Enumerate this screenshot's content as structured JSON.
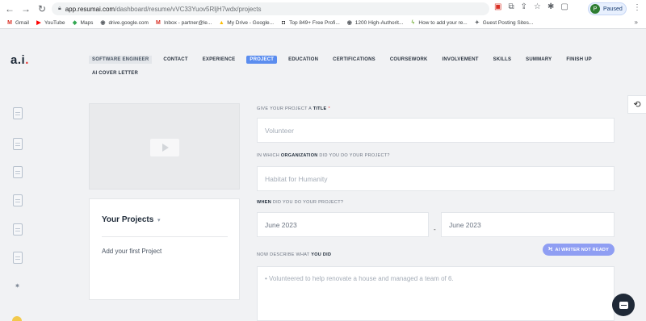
{
  "browser": {
    "url_host": "app.resumai.com",
    "url_path": "/dashboard/resume/vVC33Yuov5RljH7wdx/projects",
    "profile_label": "Paused",
    "profile_initial": "P"
  },
  "bookmarks": [
    {
      "label": "Gmail",
      "icon": "gmail-icon",
      "color": "#d93025",
      "glyph": "M"
    },
    {
      "label": "YouTube",
      "icon": "youtube-icon",
      "color": "#ff0000",
      "glyph": "▶"
    },
    {
      "label": "Maps",
      "icon": "maps-icon",
      "color": "#34a853",
      "glyph": "◆"
    },
    {
      "label": "drive.google.com",
      "icon": "globe-icon",
      "color": "#5f6368",
      "glyph": "◉"
    },
    {
      "label": "Inbox - partner@le...",
      "icon": "gmail-icon",
      "color": "#d93025",
      "glyph": "M"
    },
    {
      "label": "My Drive - Google...",
      "icon": "drive-icon",
      "color": "#fbbc04",
      "glyph": "▲"
    },
    {
      "label": "Top 849+ Free Profi...",
      "icon": "site-icon",
      "color": "#202124",
      "glyph": "◘"
    },
    {
      "label": "1200 High-Authorit...",
      "icon": "globe-icon",
      "color": "#5f6368",
      "glyph": "◉"
    },
    {
      "label": "How to add your re...",
      "icon": "bolt-icon",
      "color": "#7cb342",
      "glyph": "ϟ"
    },
    {
      "label": "Guest Posting Sites...",
      "icon": "star-icon",
      "color": "#5f6368",
      "glyph": "✦"
    }
  ],
  "app": {
    "logo_text": "a.i",
    "logo_dot": "."
  },
  "tabs": [
    {
      "label": "Software Engineer",
      "state": "soft"
    },
    {
      "label": "Contact",
      "state": "normal"
    },
    {
      "label": "Experience",
      "state": "normal"
    },
    {
      "label": "Project",
      "state": "active"
    },
    {
      "label": "Education",
      "state": "normal"
    },
    {
      "label": "Certifications",
      "state": "normal"
    },
    {
      "label": "Coursework",
      "state": "normal"
    },
    {
      "label": "Involvement",
      "state": "normal"
    },
    {
      "label": "Skills",
      "state": "normal"
    },
    {
      "label": "Summary",
      "state": "normal"
    },
    {
      "label": "Finish Up",
      "state": "normal"
    }
  ],
  "tabs_row2": [
    {
      "label": "AI Cover Letter",
      "state": "normal"
    }
  ],
  "projects_panel": {
    "title": "Your Projects",
    "add_text": "Add your first Project"
  },
  "form": {
    "title_label_pre": "Give your project a",
    "title_label_bold": "title",
    "title_label_star": "*",
    "title_placeholder": "Volunteer",
    "org_label_pre": "In which",
    "org_label_bold": "organization",
    "org_label_post": "did you do your project?",
    "org_placeholder": "Habitat for Humanity",
    "when_label_bold": "When",
    "when_label_post": "did you do your project?",
    "start_value": "June 2023",
    "dash": "-",
    "end_value": "June 2023",
    "describe_label_pre": "Now describe what",
    "describe_label_bold": "you did",
    "ai_button": "AI Writer Not Ready",
    "describe_placeholder": "• Volunteered to help renovate a house and managed a team of 6."
  },
  "colors": {
    "accent": "#5b8def",
    "ai_button": "#8f9ef3",
    "required": "#e53935"
  }
}
